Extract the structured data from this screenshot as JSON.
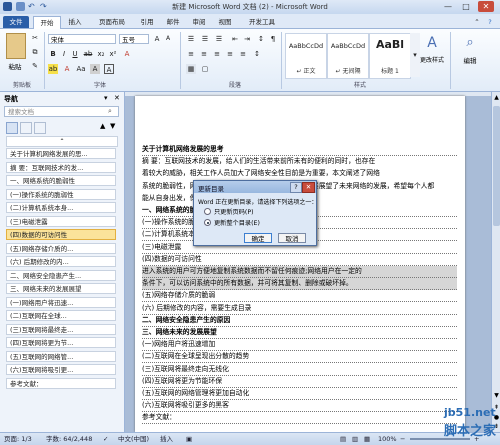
{
  "window": {
    "title": "新建 Microsoft Word 文档 (2) - Microsoft Word",
    "minimize": "—",
    "maximize": "□",
    "close": "✕"
  },
  "tabs": [
    "文件",
    "开始",
    "插入",
    "页面布局",
    "引用",
    "邮件",
    "审阅",
    "视图",
    "开发工具"
  ],
  "ribbon": {
    "font_name": "宋体",
    "font_size": "五号",
    "paste_label": "粘贴",
    "groups": {
      "clipboard": "剪贴板",
      "font": "字体",
      "paragraph": "段落",
      "styles": "样式",
      "editing": "编辑"
    },
    "styles": [
      {
        "sample": "AaBbCcDd",
        "name": "↵ 正文"
      },
      {
        "sample": "AaBbCcDd",
        "name": "↵ 无间隔"
      },
      {
        "sample": "AaBl",
        "name": "标题 1"
      }
    ],
    "change_styles": "更改样式",
    "edit_label": "编辑"
  },
  "nav": {
    "title": "导航",
    "search_placeholder": "搜索文档",
    "items": [
      "关于计算机网络发展的思...",
      "摘 要：互联网技术的发...",
      "一、网络系统的脆弱性",
      "(一)操作系统的脆弱性",
      "(二)计算机系统本身...",
      "(三)电磁泄露",
      "(四)数据的可访问性",
      "(五)网络存储介质的...",
      "(六) 后期修改的内...",
      "二、网络安全隐患产生...",
      "三、网络未来的发展展望",
      "(一)网络用户将迅速...",
      "(二)互联网在全球...",
      "(三)互联网将最终走...",
      "(四)互联网将更为节...",
      "(五)互联网的网络管...",
      "(六)互联网将吸引更...",
      "参考文献："
    ],
    "selected_index": 6
  },
  "document": {
    "lines": [
      "关于计算机网络发展的思考",
      "摘 要：互联网技术的发展，给人们的生活带来前所未有的便利的同时，也存在",
      "着较大的威胁，相关工作人员加大了网络安全性目前是为重要，本文阐述了网络",
      "系统的脆弱性，网络安全隐患产生的原因，网络未来的发展展望了未来网络的发展，希望每个人都",
      "能从自身出发，保护好计算机网络安全。",
      "一、网络系统的脆弱性",
      "(一)操作系统的脆弱性",
      "(二)计算机系统本身的脆弱性",
      "(三)电磁泄露",
      "(四)数据的可访问性",
      "进入系统的用户可方便地复制系统数据而不留任何痕迹;网络用户在一定的",
      "条件下，可以访问系统中的所有数据，并可将其复制、删除或破坏掉。",
      "(五)网络存储介质的脆弱",
      "(六) 后期修改的内容，需要生成目录",
      "二、网络安全隐患产生的原因",
      "三、网络未来的发展展望",
      "(一)网络用户将迅速增加",
      "(二)互联网在全球呈现出分散的趋势",
      "(三)互联网将最终走向无线化",
      "(四)互联网将更为节能环保",
      "(五)互联网的网络管理将更加自动化",
      "(六)互联网将吸引更多的黑客",
      "参考文献："
    ]
  },
  "dialog": {
    "title": "更新目录",
    "prompt": "Word 正在更新目录，请选择下列选项之一：",
    "options": [
      "只更新页码(P)",
      "更新整个目录(E)"
    ],
    "selected_option": 1,
    "ok": "确定",
    "cancel": "取消",
    "help": "?",
    "close": "✕"
  },
  "status": {
    "page": "页面: 1/3",
    "words": "字数: 64/2,448",
    "language": "中文(中国)",
    "mode": "插入",
    "zoom": "100%"
  },
  "watermark": {
    "line1": "jb51.net",
    "line2": "脚本之家"
  }
}
